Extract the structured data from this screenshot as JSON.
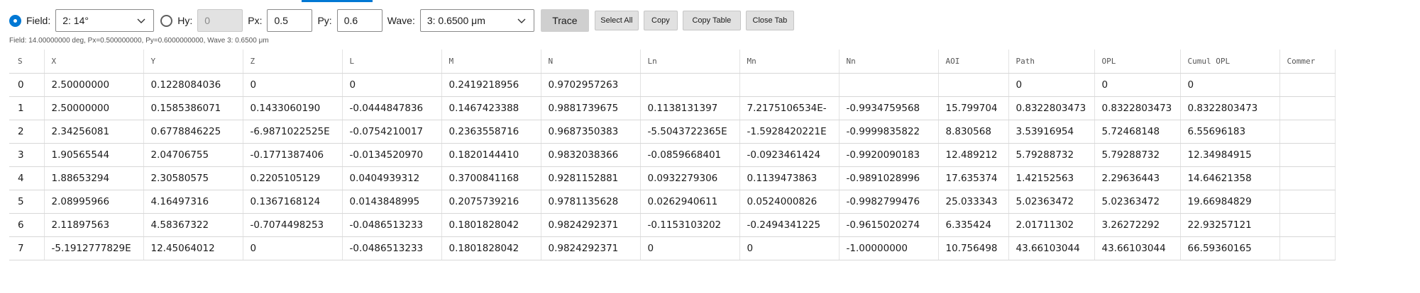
{
  "toolbar": {
    "field_label": "Field:",
    "field_value": "2: 14°",
    "hy_label": "Hy:",
    "hy_value": "0",
    "px_label": "Px:",
    "px_value": "0.5",
    "py_label": "Py:",
    "py_value": "0.6",
    "wave_label": "Wave:",
    "wave_value": "3: 0.6500 μm",
    "trace": "Trace",
    "select_all": "Select All",
    "copy": "Copy",
    "copy_table": "Copy Table",
    "close_tab": "Close Tab"
  },
  "status": "Field: 14.00000000 deg, Px=0.500000000, Py=0.6000000000, Wave 3: 0.6500 μm",
  "table": {
    "headers": [
      "S",
      "X",
      "Y",
      "Z",
      "L",
      "M",
      "N",
      "Ln",
      "Mn",
      "Nn",
      "AOI",
      "Path",
      "OPL",
      "Cumul OPL",
      "Commer"
    ],
    "rows": [
      [
        "0",
        "2.50000000",
        "0.1228084036",
        "0",
        "0",
        "0.2419218956",
        "0.9702957263",
        "",
        "",
        "",
        "",
        "0",
        "0",
        "0",
        ""
      ],
      [
        "1",
        "2.50000000",
        "0.1585386071",
        "0.1433060190",
        "-0.0444847836",
        "0.1467423388",
        "0.9881739675",
        "0.1138131397",
        "7.2175106534E-",
        "-0.9934759568",
        "15.799704",
        "0.8322803473",
        "0.8322803473",
        "0.8322803473",
        ""
      ],
      [
        "2",
        "2.34256081",
        "0.6778846225",
        "-6.9871022525E",
        "-0.0754210017",
        "0.2363558716",
        "0.9687350383",
        "-5.5043722365E",
        "-1.5928420221E",
        "-0.9999835822",
        "8.830568",
        "3.53916954",
        "5.72468148",
        "6.55696183",
        ""
      ],
      [
        "3",
        "1.90565544",
        "2.04706755",
        "-0.1771387406",
        "-0.0134520970",
        "0.1820144410",
        "0.9832038366",
        "-0.0859668401",
        "-0.0923461424",
        "-0.9920090183",
        "12.489212",
        "5.79288732",
        "5.79288732",
        "12.34984915",
        ""
      ],
      [
        "4",
        "1.88653294",
        "2.30580575",
        "0.2205105129",
        "0.0404939312",
        "0.3700841168",
        "0.9281152881",
        "0.0932279306",
        "0.1139473863",
        "-0.9891028996",
        "17.635374",
        "1.42152563",
        "2.29636443",
        "14.64621358",
        ""
      ],
      [
        "5",
        "2.08995966",
        "4.16497316",
        "0.1367168124",
        "0.0143848995",
        "0.2075739216",
        "0.9781135628",
        "0.0262940611",
        "0.0524000826",
        "-0.9982799476",
        "25.033343",
        "5.02363472",
        "5.02363472",
        "19.66984829",
        ""
      ],
      [
        "6",
        "2.11897563",
        "4.58367322",
        "-0.7074498253",
        "-0.0486513233",
        "0.1801828042",
        "0.9824292371",
        "-0.1153103202",
        "-0.2494341225",
        "-0.9615020274",
        "6.335424",
        "2.01711302",
        "3.26272292",
        "22.93257121",
        ""
      ],
      [
        "7",
        "-5.1912777829E",
        "12.45064012",
        "0",
        "-0.0486513233",
        "0.1801828042",
        "0.9824292371",
        "0",
        "0",
        "-1.00000000",
        "10.756498",
        "43.66103044",
        "43.66103044",
        "66.59360165",
        ""
      ]
    ]
  }
}
